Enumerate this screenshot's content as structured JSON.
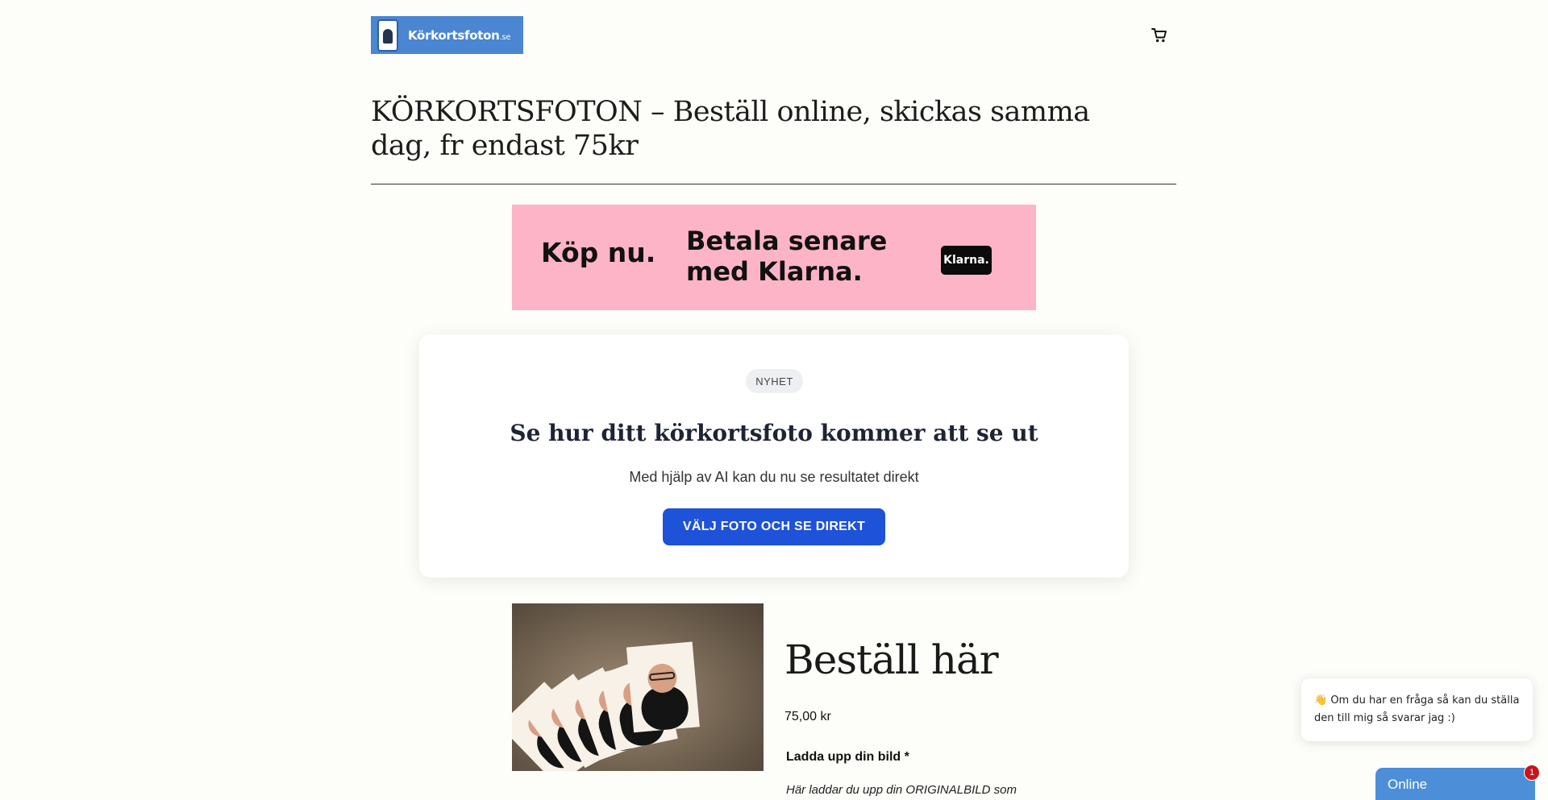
{
  "header": {
    "logo_text": "Körkortsfoton",
    "logo_tld": ".se",
    "cart_icon": "cart-icon"
  },
  "page_title": "KÖRKORTSFOTON – Beställ online, skickas samma dag, fr endast 75kr",
  "klarna_banner": {
    "left_text": "Köp nu.",
    "right_text": "Betala senare med Klarna.",
    "badge_text": "Klarna.",
    "background_color": "#feb4c7"
  },
  "ai_card": {
    "badge": "NYHET",
    "title": "Se hur ditt körkortsfoto kommer att se ut",
    "subtitle": "Med hjälp av AI kan du nu se resultatet direkt",
    "button_label": "VÄLJ FOTO OCH SE DIREKT",
    "button_color": "#1e52d8"
  },
  "product": {
    "title": "Beställ här",
    "price": "75,00 kr",
    "upload_label": "Ladda upp din bild *",
    "upload_help": "Här laddar du upp din ORIGINALBILD som"
  },
  "chat": {
    "emoji": "👋",
    "message": "Om du har en fråga så kan du ställa den till mig så svarar jag :)",
    "status_label": "Online",
    "unread_count": "1",
    "tab_color": "#4d8ed9"
  }
}
